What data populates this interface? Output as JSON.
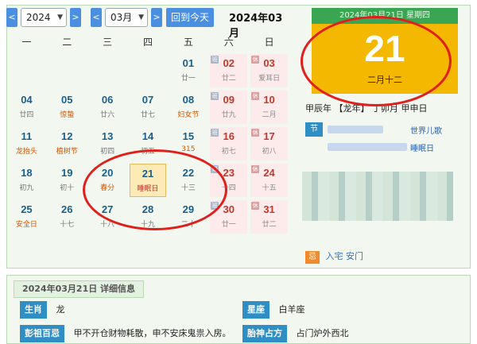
{
  "toolbar": {
    "prev_year": "<",
    "year_value": "2024",
    "next_year": ">",
    "prev_month": "<",
    "month_value": "03月",
    "next_month": ">",
    "today_label": "回到今天",
    "month_title": "2024年03月"
  },
  "weekdays": [
    "一",
    "二",
    "三",
    "四",
    "五",
    "六",
    "日"
  ],
  "days": [
    {
      "num": "",
      "lunar": ""
    },
    {
      "num": "",
      "lunar": ""
    },
    {
      "num": "",
      "lunar": ""
    },
    {
      "num": "",
      "lunar": ""
    },
    {
      "num": "01",
      "lunar": "廿一"
    },
    {
      "num": "02",
      "lunar": "廿二",
      "tag": "班"
    },
    {
      "num": "03",
      "lunar": "爱耳日",
      "tag": "休"
    },
    {
      "num": "04",
      "lunar": "廿四"
    },
    {
      "num": "05",
      "lunar": "惊蛰"
    },
    {
      "num": "06",
      "lunar": "廿六"
    },
    {
      "num": "07",
      "lunar": "廿七"
    },
    {
      "num": "08",
      "lunar": "妇女节"
    },
    {
      "num": "09",
      "lunar": "廿九",
      "tag": "班"
    },
    {
      "num": "10",
      "lunar": "二月",
      "tag": "休"
    },
    {
      "num": "11",
      "lunar": "龙抬头"
    },
    {
      "num": "12",
      "lunar": "植树节"
    },
    {
      "num": "13",
      "lunar": "初四"
    },
    {
      "num": "14",
      "lunar": "初五"
    },
    {
      "num": "15",
      "lunar": "315"
    },
    {
      "num": "16",
      "lunar": "初七",
      "tag": "班"
    },
    {
      "num": "17",
      "lunar": "初八",
      "tag": "休"
    },
    {
      "num": "18",
      "lunar": "初九"
    },
    {
      "num": "19",
      "lunar": "初十"
    },
    {
      "num": "20",
      "lunar": "春分"
    },
    {
      "num": "21",
      "lunar": "睡眠日"
    },
    {
      "num": "22",
      "lunar": "十三"
    },
    {
      "num": "23",
      "lunar": "十四",
      "tag": "班"
    },
    {
      "num": "24",
      "lunar": "十五",
      "tag": "休"
    },
    {
      "num": "25",
      "lunar": "安全日"
    },
    {
      "num": "26",
      "lunar": "十七"
    },
    {
      "num": "27",
      "lunar": "十八"
    },
    {
      "num": "28",
      "lunar": "十九"
    },
    {
      "num": "29",
      "lunar": "二十"
    },
    {
      "num": "30",
      "lunar": "廿一",
      "tag": "班"
    },
    {
      "num": "31",
      "lunar": "廿二",
      "tag": "休"
    }
  ],
  "today_index": 24,
  "date_card": {
    "header": "2024年03月21日 星期四",
    "big_day": "21",
    "lunar_date": "二月十二"
  },
  "ganzhi": "甲辰年 【龙年】 丁卯月 甲申日",
  "sidebar": {
    "jie_label": "节",
    "links": [
      "世界儿歌",
      "睡眠日"
    ]
  },
  "ji": {
    "label": "忌",
    "text": "入宅 安门"
  },
  "detail": {
    "tab_label": "2024年03月21日 详细信息",
    "shengxiao_label": "生肖",
    "shengxiao_value": "龙",
    "xingzuo_label": "星座",
    "xingzuo_value": "白羊座",
    "pengzu_label": "彭祖百忌",
    "pengzu_value": "甲不开仓财物耗散，申不安床鬼祟入房。",
    "taishen_label": "胎神占方",
    "taishen_value": "占门炉外西北"
  }
}
